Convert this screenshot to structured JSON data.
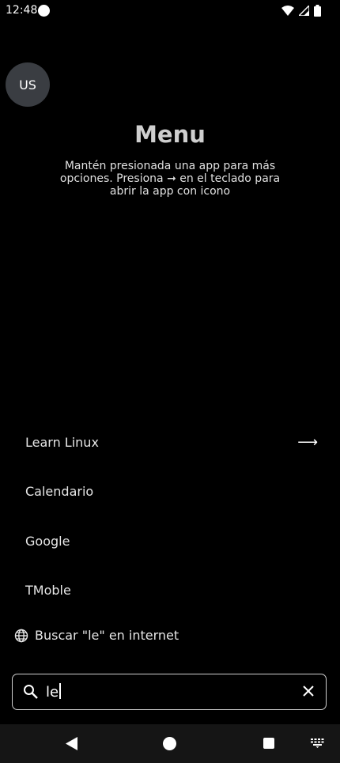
{
  "status": {
    "time": "12:48"
  },
  "profile": {
    "initials": "US"
  },
  "header": {
    "title": "Menu",
    "subtitle": "Mantén presionada una app para más opciones. Presiona ➞ en el teclado para abrir la app con icono"
  },
  "apps": [
    {
      "label": "Learn Linux",
      "has_arrow": true,
      "arrow": "⟶"
    },
    {
      "label": "Calendario"
    },
    {
      "label": "Google"
    },
    {
      "label": "TMoble"
    }
  ],
  "web_search": {
    "label": "Buscar \"le\" en internet"
  },
  "search": {
    "value": "le"
  },
  "icons": {
    "search": "search-icon",
    "clear": "close-icon",
    "globe": "globe-icon",
    "wifi": "wifi-icon",
    "signal": "signal-icon",
    "battery": "battery-icon"
  }
}
